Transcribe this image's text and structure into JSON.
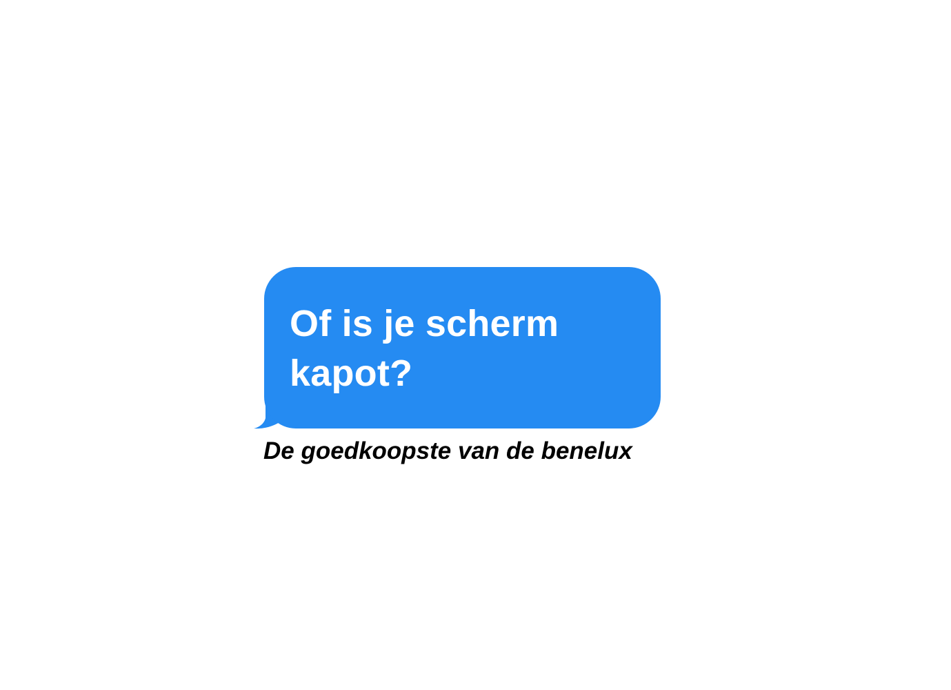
{
  "message_bubble": {
    "text": "Of is je scherm\nkapot?",
    "color": "#258BF2",
    "text_color": "#FFFFFF"
  },
  "tagline": {
    "text": "De goedkoopste van de benelux",
    "color": "#000000"
  }
}
